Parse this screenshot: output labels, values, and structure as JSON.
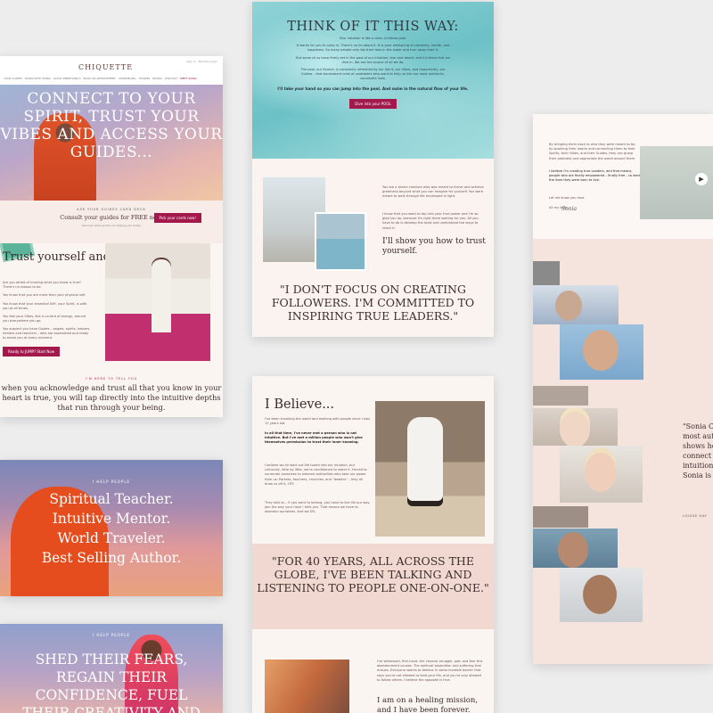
{
  "home": {
    "logo": "CHIQUETTE",
    "nav_links": [
      "YOUR GUIDES",
      "LEARN WITH SONIA",
      "GOOD VIBRATIONS ▾",
      "BOOK AN APPOINTMENT",
      "CHANNELING",
      "STORIES",
      "BOOKS",
      "PODCAST",
      "MEET SONIA"
    ],
    "top_right": [
      "Sign In",
      "Member Login"
    ],
    "hero_title": "CONNECT TO YOUR SPIRIT, TRUST YOUR VIBES AND ACCESS YOUR GUIDES...",
    "cta_kicker": "ASK YOUR GUIDES CARD DECK",
    "cta_title": "Consult your guides for FREE now.",
    "cta_button": "Pick your cards now!",
    "cta_sub": "Discover what guides are helping you today.",
    "trust_title": "Trust yourself and jump.",
    "trust_paragraphs": [
      "Are you afraid of trusting what you know is true? There's no reason to be.",
      "You know that you are more than your physical self.",
      "You know that your essential Self, your Spirit, is with you at all times.",
      "You feel your Vibes, like a current of energy, around you everywhere you go.",
      "You suspect you have Guides – angels, spirits, helpers, healers and teachers – who are assembled and ready to assist you at every moment."
    ],
    "trust_button": "Ready to JUMP? Start Now",
    "here_kicker": "I'M HERE TO TELL YOU",
    "here_text": "when you acknowledge and trust all that you know in your heart is true, you will tap directly into the intuitive depths that run through your being."
  },
  "roles": {
    "kicker": "I HELP PEOPLE",
    "lines": [
      "Spiritual Teacher.",
      "Intuitive Mentor.",
      "World Traveler.",
      "Best Selling Author."
    ]
  },
  "shed": {
    "kicker": "I HELP PEOPLE",
    "lines": [
      "SHED THEIR FEARS,",
      "REGAIN THEIR",
      "CONFIDENCE, FUEL",
      "THEIR CREATIVITY AND"
    ]
  },
  "think": {
    "title": "THINK OF IT THIS WAY:",
    "p1": "Your intuition is like a clear, limitless pool.",
    "p2": "It wants for you to jump in. There's no lie about it. It is your wellspring of creativity, health, and happiness. So many people only dip their toes in the water and turn away from it.",
    "p3": "But some of us have firmly set in the pool of our intuition, fear and doubt, and it's there that we dive in. We are the source of all we do.",
    "p4": "The pool, our Source, is constantly refreshed by our Spirit, our Vibes, and importantly, our Guides – that benevolent crew of caretakers who want to help us live our most authentic, successful lives.",
    "bold": "I'll take your hand so you can jump into the pool. And swim in the natural flow of your life.",
    "button": "Dive into your POOL",
    "side_p1": "You are a divine creature who was meant to thrive and achieve greatness beyond what you can imagine for yourself. You were meant to walk through life enveloped in light.",
    "side_p2": "I know that you want to tap into your true power and I'm so glad you do, because it's right there waiting for you. All you have to do is develop the tools and understand the ways to reach it.",
    "show": "I'll show you how to trust yourself.",
    "quote": "\"I DON'T FOCUS ON CREATING FOLLOWERS. I'M COMMITTED TO INSPIRING TRUE LEADERS.\""
  },
  "believe": {
    "title": "I Believe...",
    "p1": "I've been traveling the world and working with people since I was 12 years old.",
    "bold": "In all that time, I've never met a person who is not intuitive. But I've met a million people who won't give themselves permission to trust their inner knowing.",
    "p2": "I believe we all start out life tuned into our intuition, but culturally, little by little, we're conditioned to reject it. Forced to surrender ourselves to external authorities who take our power from us: Parents, teachers, churches, and \"leaders\" – they all draw us off it, OFF.",
    "p3": "They told us – if you want to belong, you have to live life our way. Join the way your have ! tells you. That means we have to abandon ourselves. And we DO.",
    "quote": "\"FOR 40 YEARS, ALL ACROSS THE GLOBE, I'VE BEEN TALKING AND LISTENING TO PEOPLE ONE-ON-ONE.\"",
    "p4": "I've witnessed, first-hand, the visceral struggle, pain and fear this abandonment causes. The spiritual separation and suffering that ensues. Everyone seems to believe in some invisible barrier that says you're not allowed to lead your life, and you're only allowed to follow others. I believe the opposite is true.",
    "mission": "I am on a healing mission, and I have been forever."
  },
  "about": {
    "p1": "By bringing them back to who they were meant to be, by sparking their hearts and connecting them to their Spirits, their Vibes, and their Guides, they can grasp their potential and appreciate the world around them.",
    "p2": "I believe I'm creating true Leaders, and that means, people who are finally empowered – finally free – to lead the lives they were born to live.",
    "p3": "Let me show you how.",
    "p4": "All my love,",
    "signature": "Sonia",
    "play_icon": "play-icon",
    "quote_lines": [
      "\"Sonia Ch",
      "most auth",
      "shows ho",
      "connect w",
      "intuition.",
      "Sonia is t"
    ],
    "quote_by": "LOUISE HAY"
  }
}
